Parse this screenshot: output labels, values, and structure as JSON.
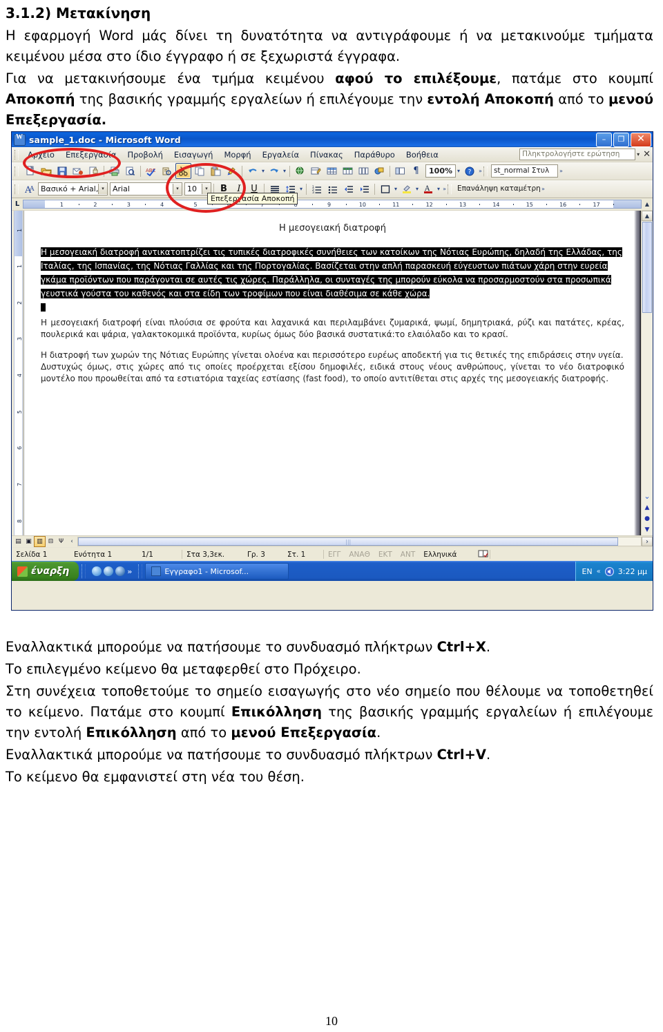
{
  "page": {
    "number": "10"
  },
  "top_text": {
    "heading": "3.1.2) Μετακίνηση",
    "paragraphs": [
      [
        {
          "t": "Η εφαρμογή Word μάς δίνει τη δυνατότητα να αντιγράφουμε ή να μετακινούμε τμήματα κειμένου μέσα στο ίδιο έγγραφο ή σε ξεχωριστά έγγραφα.",
          "b": false
        }
      ],
      [
        {
          "t": "Για να μετακινήσουμε ένα τμήμα κειμένου ",
          "b": false
        },
        {
          "t": "αφού το επιλέξουμε",
          "b": true
        },
        {
          "t": ", πατάμε στο κουμπί ",
          "b": false
        },
        {
          "t": "Αποκοπή",
          "b": true
        },
        {
          "t": " της βασικής γραμμής εργαλείων ή επιλέγουμε την ",
          "b": false
        },
        {
          "t": "εντολή Αποκοπή",
          "b": true
        },
        {
          "t": " από το ",
          "b": false
        },
        {
          "t": "μενού Επεξεργασία.",
          "b": true
        }
      ]
    ]
  },
  "bottom_text": {
    "paragraphs": [
      [
        {
          "t": "Εναλλακτικά μπορούμε να πατήσουμε το συνδυασμό πλήκτρων ",
          "b": false
        },
        {
          "t": "Ctrl+X",
          "b": true
        },
        {
          "t": ".",
          "b": false
        }
      ],
      [
        {
          "t": "Το επιλεγμένο κείμενο θα μεταφερθεί στο Πρόχειρο.",
          "b": false
        }
      ],
      [
        {
          "t": "Στη συνέχεια τοποθετούμε το σημείο εισαγωγής στο νέο σημείο που θέλουμε να τοποθετηθεί το κείμενο. Πατάμε στο κουμπί ",
          "b": false
        },
        {
          "t": "Επικόλληση",
          "b": true
        },
        {
          "t": " της βασικής γραμμής εργαλείων ή επιλέγουμε την εντολή ",
          "b": false
        },
        {
          "t": "Επικόλληση",
          "b": true
        },
        {
          "t": " από το ",
          "b": false
        },
        {
          "t": "μενού Επεξεργασία",
          "b": true
        },
        {
          "t": ".",
          "b": false
        }
      ],
      [
        {
          "t": "Εναλλακτικά μπορούμε να πατήσουμε το συνδυασμό πλήκτρων ",
          "b": false
        },
        {
          "t": "Ctrl+V",
          "b": true
        },
        {
          "t": ".",
          "b": false
        }
      ],
      [
        {
          "t": "Το κείμενο θα εμφανιστεί στη νέα του θέση.",
          "b": false
        }
      ]
    ]
  },
  "word_window": {
    "title": "sample_1.doc - Microsoft Word",
    "window_buttons": {
      "minimize": "–",
      "restore": "❐",
      "close": "✕"
    },
    "menu_items": [
      "Αρχείο",
      "Επεξεργασία",
      "Προβολή",
      "Εισαγωγή",
      "Μορφή",
      "Εργαλεία",
      "Πίνακας",
      "Παράθυρο",
      "Βοήθεια"
    ],
    "ask_a_question": {
      "placeholder": "Πληκτρολογήστε ερώτηση",
      "dropdown_arrow": "▾",
      "close": "✕"
    },
    "standard_toolbar": {
      "zoom_value": "100%",
      "zoom_arrow": "▾",
      "style_box": "st_normal Στυλ",
      "overflow": "»",
      "icons": [
        "new-document-icon",
        "open-folder-icon",
        "save-icon",
        "email-icon",
        "permission-icon",
        "print-icon",
        "print-preview-icon",
        "spelling-check-icon",
        "research-icon",
        "cut-icon",
        "copy-icon",
        "paste-icon",
        "format-painter-icon",
        "undo-icon",
        "redo-icon",
        "hyperlink-icon",
        "tables-borders-icon",
        "insert-table-icon",
        "insert-excel-icon",
        "columns-icon",
        "drawing-icon",
        "document-map-icon",
        "show-formatting-icon"
      ]
    },
    "formatting_toolbar": {
      "style_value": "Βασικό + Arial,",
      "font_value": "Arial",
      "size_value": "10",
      "bold": "B",
      "italic": "I",
      "underline": "U",
      "overflow": "»",
      "right_pane": "Επανάληψη καταμέτρησης"
    },
    "tooltip": "Επεξεργασία Αποκοπή",
    "ruler": {
      "tab_selector": "L",
      "numbers": [
        "1",
        "2",
        "3",
        "4",
        "5",
        "6",
        "7",
        "8",
        "9",
        "10",
        "11",
        "12",
        "13",
        "14",
        "15",
        "16",
        "17"
      ]
    },
    "vertical_ruler": {
      "numbers": [
        "1",
        "1",
        "2",
        "3",
        "4",
        "5",
        "6",
        "7",
        "8"
      ]
    },
    "document": {
      "title": "Η μεσογειακή διατροφή",
      "selected_paragraph": "Η μεσογειακή διατροφή αντικατοπτρίζει τις τυπικές διατροφικές συνήθειες των κατοίκων της Νότιας Ευρώπης, δηλαδή της Ελλάδας, της Ιταλίας, της Ισπανίας, της Νότιας Γαλλίας και της Πορτογαλίας. Βασίζεται στην απλή παρασκευή εύγευστων πιάτων χάρη στην ευρεία γκάμα προϊόντων που παράγονται σε αυτές τις χώρες. Παράλληλα, οι συνταγές της μπορούν εύκολα να προσαρμοστούν στα προσωπικά γευστικά γούστα του καθενός και στα είδη των τροφίμων που είναι διαθέσιμα σε κάθε χώρα.",
      "paragraphs": [
        "Η μεσογειακή διατροφή είναι πλούσια σε φρούτα και λαχανικά και περιλαμβάνει ζυμαρικά, ψωμί, δημητριακά, ρύζι και πατάτες, κρέας, πουλερικά και ψάρια, γαλακτοκομικά προϊόντα, κυρίως όμως δύο βασικά συστατικά:το ελαιόλαδο και το κρασί.",
        "Η διατροφή των χωρών της Νότιας Ευρώπης γίνεται ολοένα και περισσότερο ευρέως αποδεκτή για τις θετικές της επιδράσεις στην υγεία.",
        "Δυστυχώς όμως, στις χώρες από τις οποίες προέρχεται εξίσου δημοφιλές, ειδικά στους νέους ανθρώπους, γίνεται το νέο διατροφικό μοντέλο που προωθείται από τα εστιατόρια ταχείας εστίασης (fast food), το οποίο αντιτίθεται στις αρχές της μεσογειακής διατροφής."
      ]
    },
    "view_buttons": [
      "normal-view-icon",
      "web-layout-view-icon",
      "print-layout-view-icon",
      "outline-view-icon",
      "reading-layout-view-icon"
    ],
    "status_bar": {
      "page_label": "Σελίδα 1",
      "section_label": "Ενότητα 1",
      "page_of": "1/1",
      "at": "Στα 3,3εκ.",
      "line": "Γρ. 3",
      "column": "Στ. 1",
      "indicators": [
        "ΕΓΓ",
        "ΑΝΑΘ",
        "ΕΚΤ",
        "ΑΝΤ"
      ],
      "language": "Ελληνικά",
      "spell_icon": "spell-check-status-icon"
    },
    "taskbar": {
      "start_label": "έναρξη",
      "quick_launch_overflow": "»",
      "task_item": "Εγγραφο1 - Microsof...",
      "tray_language": "EN",
      "tray_chevron": "«",
      "clock": "3:22 μμ"
    }
  },
  "annotations": {
    "colors": {
      "ellipse": "#e02020"
    },
    "ellipses": [
      "edit-menu-highlight",
      "cut-button-highlight"
    ]
  }
}
